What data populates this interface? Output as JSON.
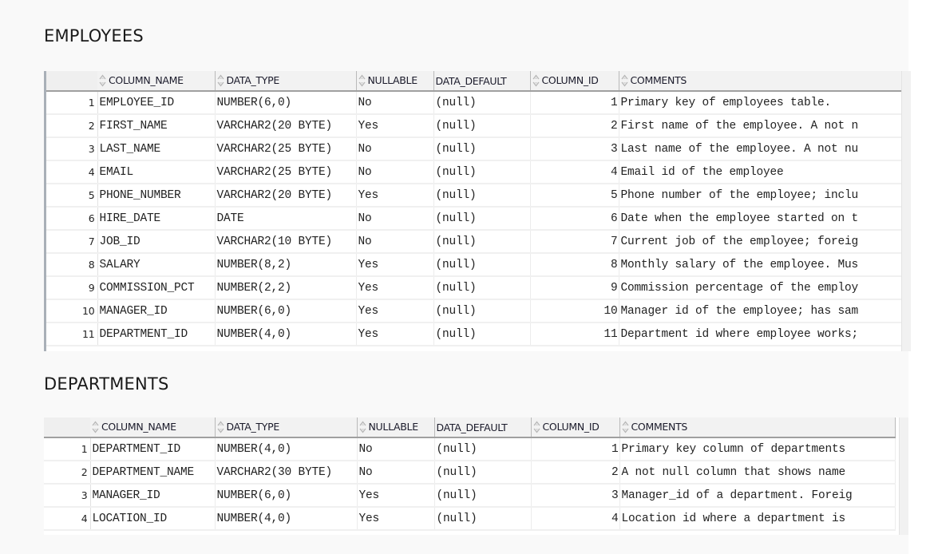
{
  "employees": {
    "title": "EMPLOYEES",
    "columns": [
      {
        "label": "COLUMN_NAME",
        "sortable": true,
        "icon": "sort-icon"
      },
      {
        "label": "DATA_TYPE",
        "sortable": true,
        "icon": "sort-icon"
      },
      {
        "label": "NULLABLE",
        "sortable": true,
        "icon": "sort-icon"
      },
      {
        "label": "DATA_DEFAULT",
        "sortable": false
      },
      {
        "label": "COLUMN_ID",
        "sortable": true,
        "icon": "sort-icon"
      },
      {
        "label": "COMMENTS",
        "sortable": true,
        "icon": "sort-icon"
      }
    ],
    "rows": [
      {
        "n": "1",
        "column_name": "EMPLOYEE_ID",
        "data_type": "NUMBER(6,0)",
        "nullable": "No",
        "data_default": "(null)",
        "column_id": "1",
        "comments": "Primary key of employees table."
      },
      {
        "n": "2",
        "column_name": "FIRST_NAME",
        "data_type": "VARCHAR2(20 BYTE)",
        "nullable": "Yes",
        "data_default": "(null)",
        "column_id": "2",
        "comments": "First name of the employee. A not n"
      },
      {
        "n": "3",
        "column_name": "LAST_NAME",
        "data_type": "VARCHAR2(25 BYTE)",
        "nullable": "No",
        "data_default": "(null)",
        "column_id": "3",
        "comments": "Last name of the employee. A not nu"
      },
      {
        "n": "4",
        "column_name": "EMAIL",
        "data_type": "VARCHAR2(25 BYTE)",
        "nullable": "No",
        "data_default": "(null)",
        "column_id": "4",
        "comments": "Email id of the employee"
      },
      {
        "n": "5",
        "column_name": "PHONE_NUMBER",
        "data_type": "VARCHAR2(20 BYTE)",
        "nullable": "Yes",
        "data_default": "(null)",
        "column_id": "5",
        "comments": "Phone number of the employee; inclu"
      },
      {
        "n": "6",
        "column_name": "HIRE_DATE",
        "data_type": "DATE",
        "nullable": "No",
        "data_default": "(null)",
        "column_id": "6",
        "comments": "Date when the employee started on t"
      },
      {
        "n": "7",
        "column_name": "JOB_ID",
        "data_type": "VARCHAR2(10 BYTE)",
        "nullable": "No",
        "data_default": "(null)",
        "column_id": "7",
        "comments": "Current job of the employee; foreig"
      },
      {
        "n": "8",
        "column_name": "SALARY",
        "data_type": "NUMBER(8,2)",
        "nullable": "Yes",
        "data_default": "(null)",
        "column_id": "8",
        "comments": "Monthly salary of the employee. Mus"
      },
      {
        "n": "9",
        "column_name": "COMMISSION_PCT",
        "data_type": "NUMBER(2,2)",
        "nullable": "Yes",
        "data_default": "(null)",
        "column_id": "9",
        "comments": "Commission percentage of the employ"
      },
      {
        "n": "10",
        "column_name": "MANAGER_ID",
        "data_type": "NUMBER(6,0)",
        "nullable": "Yes",
        "data_default": "(null)",
        "column_id": "10",
        "comments": "Manager id of the employee; has sam"
      },
      {
        "n": "11",
        "column_name": "DEPARTMENT_ID",
        "data_type": "NUMBER(4,0)",
        "nullable": "Yes",
        "data_default": "(null)",
        "column_id": "11",
        "comments": "Department id where employee works;"
      }
    ]
  },
  "departments": {
    "title": "DEPARTMENTS",
    "columns": [
      {
        "label": "COLUMN_NAME",
        "sortable": true,
        "icon": "sort-icon"
      },
      {
        "label": "DATA_TYPE",
        "sortable": true,
        "icon": "sort-icon"
      },
      {
        "label": "NULLABLE",
        "sortable": true,
        "icon": "sort-icon"
      },
      {
        "label": "DATA_DEFAULT",
        "sortable": false
      },
      {
        "label": "COLUMN_ID",
        "sortable": true,
        "icon": "sort-icon"
      },
      {
        "label": "COMMENTS",
        "sortable": true,
        "icon": "sort-icon"
      }
    ],
    "rows": [
      {
        "n": "1",
        "column_name": "DEPARTMENT_ID",
        "data_type": "NUMBER(4,0)",
        "nullable": "No",
        "data_default": "(null)",
        "column_id": "1",
        "comments": "Primary key column of departments"
      },
      {
        "n": "2",
        "column_name": "DEPARTMENT_NAME",
        "data_type": "VARCHAR2(30 BYTE)",
        "nullable": "No",
        "data_default": "(null)",
        "column_id": "2",
        "comments": "A not null column that shows name"
      },
      {
        "n": "3",
        "column_name": "MANAGER_ID",
        "data_type": "NUMBER(6,0)",
        "nullable": "Yes",
        "data_default": "(null)",
        "column_id": "3",
        "comments": "Manager_id of a department. Foreig"
      },
      {
        "n": "4",
        "column_name": "LOCATION_ID",
        "data_type": "NUMBER(4,0)",
        "nullable": "Yes",
        "data_default": "(null)",
        "column_id": "4",
        "comments": "Location id where a department is"
      }
    ]
  }
}
